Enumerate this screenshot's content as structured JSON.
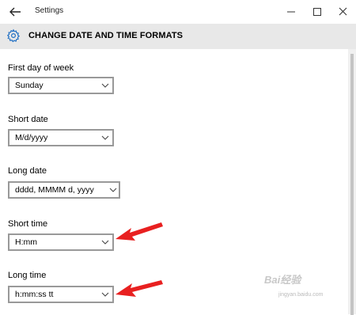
{
  "window": {
    "title": "Settings"
  },
  "header": {
    "title": "CHANGE DATE AND TIME FORMATS"
  },
  "fields": {
    "first_day": {
      "label": "First day of week",
      "value": "Sunday"
    },
    "short_date": {
      "label": "Short date",
      "value": "M/d/yyyy"
    },
    "long_date": {
      "label": "Long date",
      "value": "dddd, MMMM d, yyyy"
    },
    "short_time": {
      "label": "Short time",
      "value": "H:mm"
    },
    "long_time": {
      "label": "Long time",
      "value": "h:mm:ss tt"
    }
  },
  "watermark": {
    "text": "Bai经验",
    "sub": "jingyan.baidu.com"
  },
  "colors": {
    "header_bg": "#e8e8e8",
    "dropdown_border": "#999999",
    "annotation_arrow": "#e82020"
  },
  "icons": {
    "back": "back-arrow-icon",
    "settings": "gear-icon",
    "minimize": "minimize-icon",
    "maximize": "maximize-icon",
    "close": "close-icon",
    "dropdown": "chevron-down-icon"
  }
}
